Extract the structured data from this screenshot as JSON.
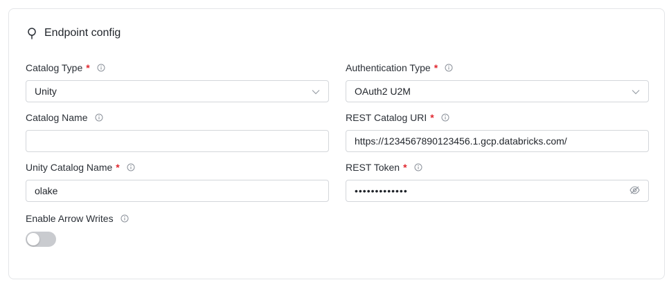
{
  "section": {
    "title": "Endpoint config",
    "icon": "location-pin-icon"
  },
  "left": {
    "catalog_type": {
      "label": "Catalog Type",
      "required": "*",
      "value": "Unity"
    },
    "catalog_name": {
      "label": "Catalog Name",
      "value": ""
    },
    "unity_catalog_name": {
      "label": "Unity Catalog Name",
      "required": "*",
      "value": "olake"
    },
    "enable_arrow_writes": {
      "label": "Enable Arrow Writes",
      "enabled": false
    }
  },
  "right": {
    "authentication_type": {
      "label": "Authentication Type",
      "required": "*",
      "value": "OAuth2 U2M"
    },
    "rest_catalog_uri": {
      "label": "REST Catalog URI",
      "required": "*",
      "value": "https://1234567890123456.1.gcp.databricks.com/"
    },
    "rest_token": {
      "label": "REST Token",
      "required": "*",
      "masked_value": "•••••••••••••"
    }
  },
  "colors": {
    "required": "#e0262e",
    "border": "#d3d6da",
    "toggle_off": "#c9cbcf"
  },
  "icons": [
    "location-pin-icon",
    "info-icon",
    "chevron-down-icon",
    "eye-slash-icon"
  ]
}
